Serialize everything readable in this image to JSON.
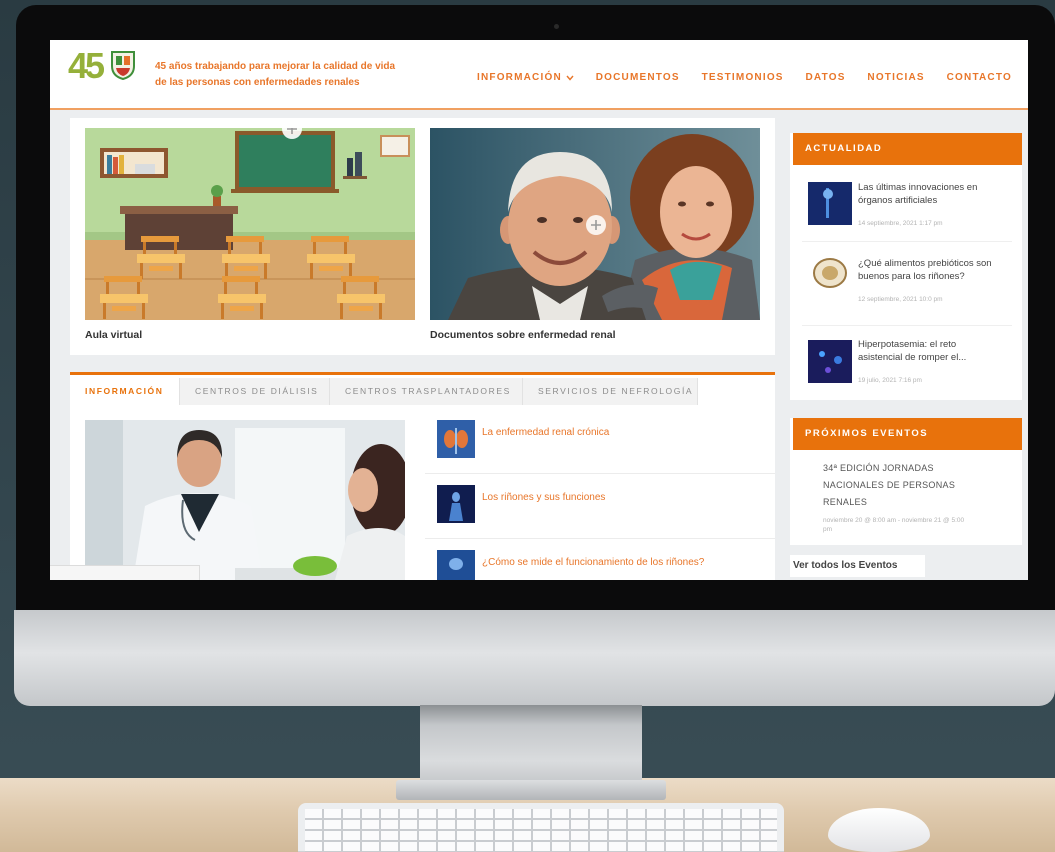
{
  "colors": {
    "accent": "#e8720c",
    "link": "#e8762a",
    "logo": "#95b03a",
    "text": "#444444",
    "background": "#33454c"
  },
  "icons": {
    "nav_dropdown": "chevron-down-icon",
    "image_hover": "plus-circle-icon",
    "logo_seal": "logo-seal-icon"
  },
  "header": {
    "logo_text": "45",
    "tagline_lines": [
      "45 años trabajando para mejorar la calidad de vida",
      "de las personas con enfermedades renales"
    ],
    "nav": [
      {
        "label": "INFORMACIÓN",
        "has_dropdown": true
      },
      {
        "label": "DOCUMENTOS"
      },
      {
        "label": "TESTIMONIOS"
      },
      {
        "label": "DATOS"
      },
      {
        "label": "NOTICIAS"
      },
      {
        "label": "CONTACTO"
      }
    ]
  },
  "featured": [
    {
      "caption": "Aula virtual"
    },
    {
      "caption": "Documentos sobre enfermedad renal"
    }
  ],
  "tabs": {
    "items": [
      "INFORMACIÓN",
      "CENTROS DE DIÁLISIS",
      "CENTROS TRASPLANTADORES",
      "SERVICIOS DE NEFROLOGÍA"
    ],
    "active": "INFORMACIÓN",
    "links": [
      "La enfermedad renal crónica",
      "Los riñones y sus funciones",
      "¿Cómo se mide el funcionamiento de los riñones?"
    ]
  },
  "sidebar": {
    "news": {
      "title": "ACTUALIDAD",
      "items": [
        {
          "title": "Las últimas innovaciones en órganos artificiales",
          "date": "14 septiembre, 2021 1:17 pm"
        },
        {
          "title": "¿Qué alimentos prebióticos son buenos para los riñones?",
          "date": "12 septiembre, 2021 10:0 pm"
        },
        {
          "title": "Hiperpotasemia: el reto asistencial de romper el...",
          "date": "19 julio, 2021 7:16 pm"
        }
      ]
    },
    "events": {
      "title": "PRÓXIMOS EVENTOS",
      "items": [
        {
          "title": "34ª EDICIÓN JORNADAS NACIONALES DE PERSONAS RENALES",
          "date": "noviembre 20 @ 8:00 am - noviembre 21 @ 5:00 pm"
        }
      ],
      "more_label": "Ver todos los Eventos"
    }
  }
}
